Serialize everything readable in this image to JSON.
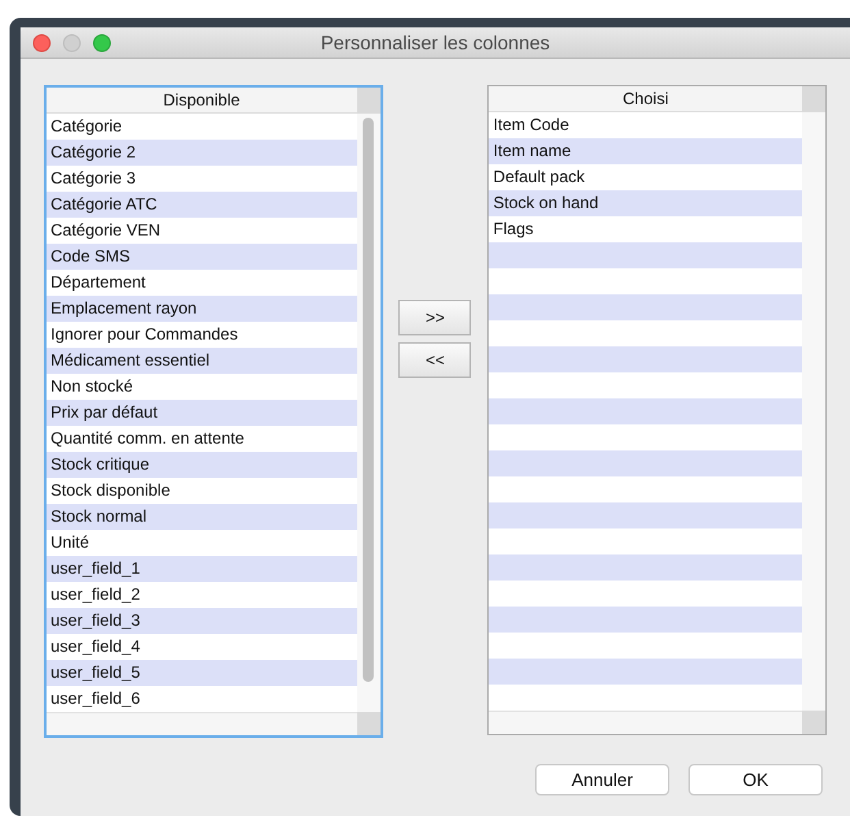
{
  "window": {
    "title": "Personnaliser les colonnes"
  },
  "lists": [
    {
      "header": "Disponible",
      "focused": true,
      "scrollbar": true,
      "items": [
        "Catégorie",
        "Catégorie 2",
        "Catégorie 3",
        "Catégorie ATC",
        "Catégorie VEN",
        "Code SMS",
        "Département",
        "Emplacement rayon",
        "Ignorer pour Commandes",
        "Médicament essentiel",
        "Non stocké",
        "Prix par défaut",
        "Quantité comm. en attente",
        "Stock critique",
        "Stock disponible",
        "Stock normal",
        "Unité",
        "user_field_1",
        "user_field_2",
        "user_field_3",
        "user_field_4",
        "user_field_5",
        "user_field_6"
      ]
    },
    {
      "header": "Choisi",
      "focused": false,
      "scrollbar": false,
      "items": [
        "Item Code",
        "Item name",
        "Default pack",
        "Stock on hand",
        "Flags"
      ]
    }
  ],
  "move_buttons": [
    ">>",
    "<<"
  ],
  "buttons": [
    "Annuler",
    "OK"
  ]
}
